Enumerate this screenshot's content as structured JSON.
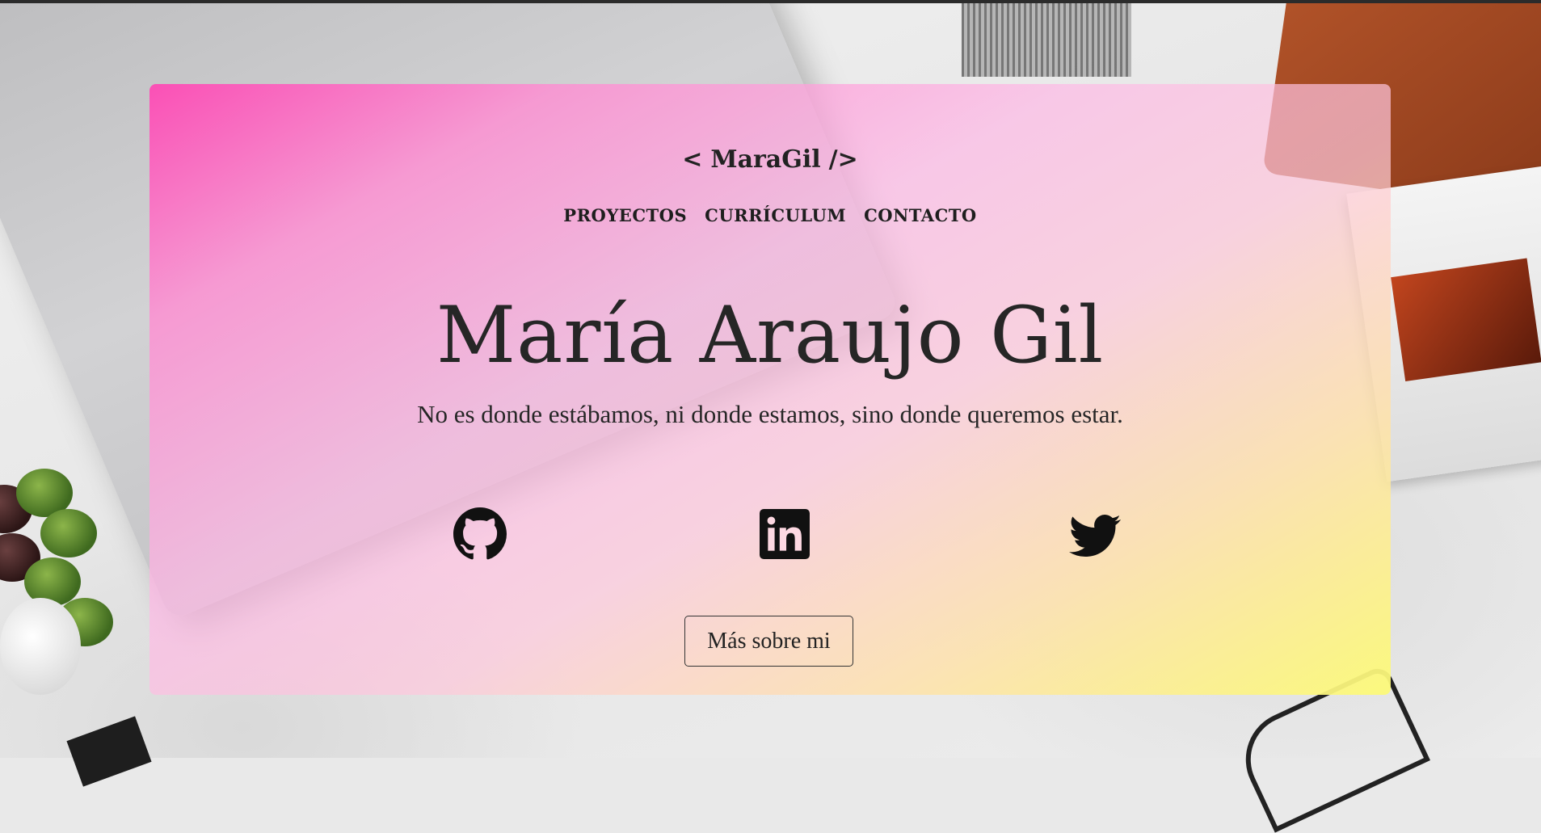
{
  "header": {
    "logo_left": "<",
    "logo_text": "MaraGil",
    "logo_right": "/>"
  },
  "nav": {
    "items": [
      {
        "label": "PROYECTOS"
      },
      {
        "label": "CURRÍCULUM"
      },
      {
        "label": "CONTACTO"
      }
    ]
  },
  "hero": {
    "name": "María Araujo Gil",
    "motto": "No es donde estábamos, ni donde estamos, sino donde queremos estar.",
    "button_label": "Más sobre mi"
  },
  "social": [
    {
      "icon": "github-icon"
    },
    {
      "icon": "linkedin-icon"
    },
    {
      "icon": "twitter-icon"
    }
  ],
  "colors": {
    "gradient_start": "#ff46b4",
    "gradient_mid": "#ffb9e6",
    "gradient_end": "#fcfa78",
    "text": "#262626"
  }
}
